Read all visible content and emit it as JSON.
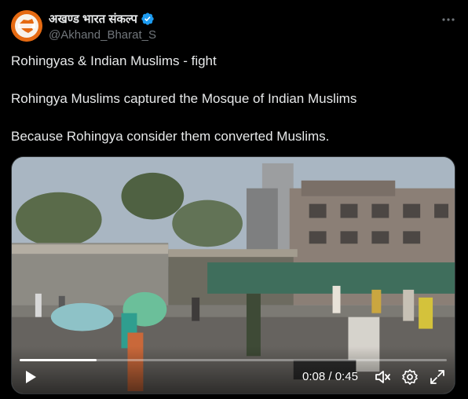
{
  "author": {
    "display_name": "अखण्ड भारत संकल्प",
    "handle": "@Akhand_Bharat_S",
    "verified": true,
    "verified_color": "#1d9bf0",
    "avatar_color": "#e56a12"
  },
  "tweet": {
    "lines": [
      "Rohingyas &  Indian Muslims - fight",
      "Rohingya Muslims captured the Mosque of Indian Muslims",
      "Because Rohingya consider them converted Muslims."
    ]
  },
  "video": {
    "current_time": "0:08",
    "separator": " / ",
    "duration": "0:45",
    "progress": 0.18,
    "muted": true,
    "icons": [
      "play-icon",
      "muted-speaker-icon",
      "settings-gear-icon",
      "fullscreen-expand-icon"
    ]
  },
  "icons": {
    "more": "more-horizontal-icon",
    "verified": "verified-badge-icon"
  }
}
